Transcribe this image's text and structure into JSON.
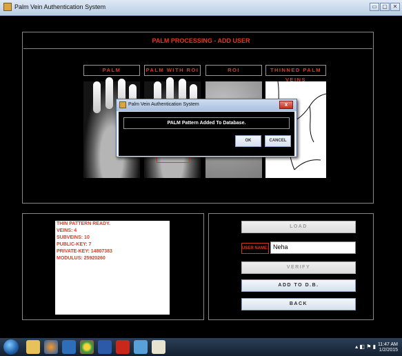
{
  "window": {
    "title": "Palm Vein Authentication System",
    "controls": {
      "minimize": "▭",
      "maximize": "▢",
      "close": "✕"
    }
  },
  "header": {
    "title": "PALM PROCESSING - ADD USER"
  },
  "image_panels": [
    {
      "label": "PALM"
    },
    {
      "label": "PALM WITH ROI"
    },
    {
      "label": "ROI"
    },
    {
      "label": "THINNED PALM VEINS"
    }
  ],
  "output": {
    "lines": [
      "THIN PATTERN READY.",
      "VEINS: 4",
      "SUBVEINS: 10",
      "PUBLIC-KEY: 7",
      "PRIVATE-KEY: 14807383",
      "MODULUS: 25920260"
    ]
  },
  "controls": {
    "load_label": "LOAD",
    "username_label": "USER NAME:",
    "username_value": "Neha",
    "verify_label": "VERIFY",
    "add_label": "ADD TO D.B.",
    "back_label": "BACK"
  },
  "dialog": {
    "title": "Palm Vein Authentication System",
    "message": "PALM Pattern Added To Database.",
    "ok_label": "OK",
    "cancel_label": "CANCEL",
    "close_glyph": "x"
  },
  "taskbar": {
    "time": "11:47 AM",
    "date": "1/2/2015",
    "apps": [
      "explorer-icon",
      "firefox-icon",
      "media-player-icon",
      "chrome-icon",
      "word-icon",
      "pdf-reader-icon",
      "app-icon",
      "paint-icon"
    ]
  },
  "colors": {
    "accent": "#e03a1f",
    "background": "#000000",
    "panel_border": "#8a8a8a"
  }
}
